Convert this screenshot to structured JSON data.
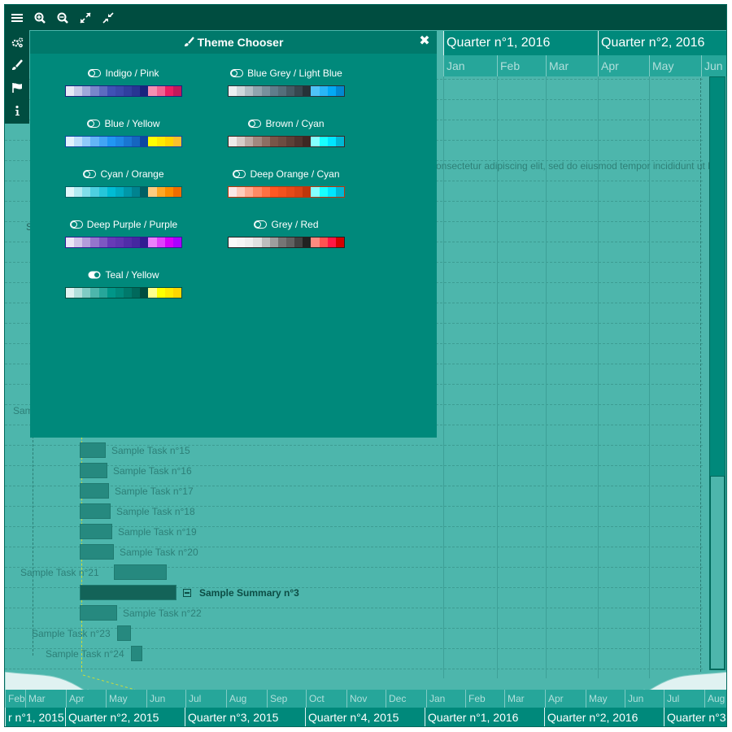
{
  "toolbar": {
    "buttons": [
      "menu-icon",
      "zoom-in-icon",
      "zoom-out-icon",
      "expand-icon",
      "collapse-icon"
    ]
  },
  "sidebar": {
    "buttons": [
      "settings-icon",
      "brush-icon",
      "flag-icon",
      "info-icon"
    ]
  },
  "header": {
    "quarters": [
      "Quarter n°1, 2016",
      "Quarter n°2, 2016"
    ],
    "months": [
      "Jan",
      "Feb",
      "Mar",
      "Apr",
      "May",
      "Jun"
    ]
  },
  "panel": {
    "title": "Theme Chooser",
    "themes": [
      {
        "name": "Indigo / Pink",
        "selected": false,
        "colors": [
          "#e8eaf6",
          "#c5cae9",
          "#9fa8da",
          "#7986cb",
          "#5c6bc0",
          "#3f51b5",
          "#3949ab",
          "#303f9f",
          "#283593",
          "#1a237e",
          "#f48fb1",
          "#f06292",
          "#e91e63",
          "#c2185b"
        ],
        "border": "#1a237e"
      },
      {
        "name": "Blue Grey / Light Blue",
        "selected": false,
        "colors": [
          "#eceff1",
          "#cfd8dc",
          "#b0bec5",
          "#90a4ae",
          "#78909c",
          "#607d8b",
          "#546e7a",
          "#455a64",
          "#37474f",
          "#263238",
          "#4fc3f7",
          "#29b6f6",
          "#03a9f4",
          "#0288d1"
        ],
        "border": "#263238"
      },
      {
        "name": "Blue / Yellow",
        "selected": false,
        "colors": [
          "#e3f2fd",
          "#bbdefb",
          "#90caf9",
          "#64b5f6",
          "#42a5f5",
          "#2196f3",
          "#1e88e5",
          "#1976d2",
          "#1565c0",
          "#0d47a1",
          "#ffff00",
          "#ffea00",
          "#ffd600",
          "#fbc02d"
        ],
        "border": "#0d47a1"
      },
      {
        "name": "Brown / Cyan",
        "selected": false,
        "colors": [
          "#efebe9",
          "#d7ccc8",
          "#bcaaa4",
          "#a1887f",
          "#8d6e63",
          "#795548",
          "#6d4c41",
          "#5d4037",
          "#4e342e",
          "#3e2723",
          "#84ffff",
          "#18ffff",
          "#00e5ff",
          "#00b8d4"
        ],
        "border": "#3e2723"
      },
      {
        "name": "Cyan / Orange",
        "selected": false,
        "colors": [
          "#e0f7fa",
          "#b2ebf2",
          "#80deea",
          "#4dd0e1",
          "#26c6da",
          "#00bcd4",
          "#00acc1",
          "#0097a7",
          "#00838f",
          "#006064",
          "#ffcc80",
          "#ffa726",
          "#fb8c00",
          "#ef6c00"
        ],
        "border": "#006064"
      },
      {
        "name": "Deep Orange / Cyan",
        "selected": false,
        "colors": [
          "#fbe9e7",
          "#ffccbc",
          "#ffab91",
          "#ff8a65",
          "#ff7043",
          "#ff5722",
          "#f4511e",
          "#e64a19",
          "#d84315",
          "#bf360c",
          "#84ffff",
          "#18ffff",
          "#00e5ff",
          "#00b8d4"
        ],
        "border": "#bf360c"
      },
      {
        "name": "Deep Purple / Purple",
        "selected": false,
        "colors": [
          "#ede7f6",
          "#d1c4e9",
          "#b39ddb",
          "#9575cd",
          "#7e57c2",
          "#673ab7",
          "#5e35b1",
          "#512da8",
          "#4527a0",
          "#311b92",
          "#ea80fc",
          "#e040fb",
          "#d500f9",
          "#aa00ff"
        ],
        "border": "#311b92"
      },
      {
        "name": "Grey / Red",
        "selected": false,
        "colors": [
          "#fafafa",
          "#f5f5f5",
          "#eeeeee",
          "#e0e0e0",
          "#bdbdbd",
          "#9e9e9e",
          "#757575",
          "#616161",
          "#424242",
          "#212121",
          "#ff8a80",
          "#ff5252",
          "#ff1744",
          "#d50000"
        ],
        "border": "#212121"
      },
      {
        "name": "Teal / Yellow",
        "selected": true,
        "colors": [
          "#e0f2f1",
          "#b2dfdb",
          "#80cbc4",
          "#4db6ac",
          "#26a69a",
          "#009688",
          "#00897b",
          "#00796b",
          "#00695c",
          "#004d40",
          "#ffff8d",
          "#ffff00",
          "#ffea00",
          "#ffd600"
        ],
        "border": "#004d40"
      }
    ]
  },
  "gantt": {
    "lorem_text": "onsectetur adipiscing elit, sed do eiusmod tempor incididunt ut la",
    "fragments": [
      "S",
      "Samp"
    ],
    "tasks": [
      {
        "label": "Sample Task n°15"
      },
      {
        "label": "Sample Task n°16"
      },
      {
        "label": "Sample Task n°17"
      },
      {
        "label": "Sample Task n°18"
      },
      {
        "label": "Sample Task n°19"
      },
      {
        "label": "Sample Task n°20"
      },
      {
        "label": "Sample Task n°21"
      },
      {
        "label": "Sample Summary n°3"
      },
      {
        "label": "Sample Task n°22"
      },
      {
        "label": "Sample Task n°23"
      },
      {
        "label": "Sample Task n°24"
      }
    ]
  },
  "footer": {
    "months": [
      "Feb",
      "Mar",
      "Apr",
      "May",
      "Jun",
      "Jul",
      "Aug",
      "Sep",
      "Oct",
      "Nov",
      "Dec",
      "Jan",
      "Feb",
      "Mar",
      "Apr",
      "May",
      "Jun",
      "Jul",
      "Aug"
    ],
    "quarters": [
      "r n°1, 2015",
      "Quarter n°2, 2015",
      "Quarter n°3, 2015",
      "Quarter n°4, 2015",
      "Quarter n°1, 2016",
      "Quarter n°2, 2016",
      "Quarter n°3"
    ]
  }
}
